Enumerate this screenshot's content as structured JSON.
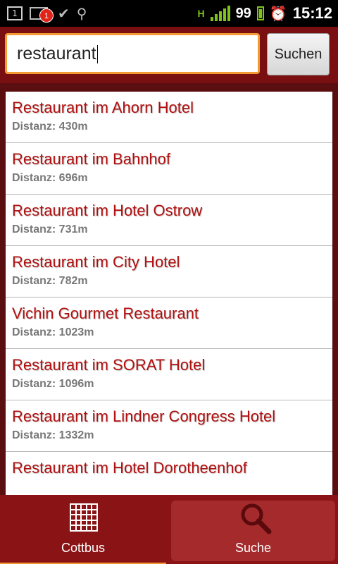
{
  "status_bar": {
    "sim_label": "1",
    "notification_badge": "1",
    "network_type": "H",
    "battery": "99",
    "time": "15:12",
    "icons": [
      "sim-icon",
      "mail-icon",
      "shopping-bag-icon",
      "usb-icon",
      "hspa-icon",
      "signal-icon",
      "battery-icon",
      "alarm-icon"
    ]
  },
  "search": {
    "value": "restaurant",
    "button_label": "Suchen"
  },
  "results": [
    {
      "name": "Restaurant im Ahorn Hotel",
      "distance": "Distanz: 430m"
    },
    {
      "name": "Restaurant im Bahnhof",
      "distance": "Distanz: 696m"
    },
    {
      "name": "Restaurant im Hotel Ostrow",
      "distance": "Distanz: 731m"
    },
    {
      "name": "Restaurant im City Hotel",
      "distance": "Distanz: 782m"
    },
    {
      "name": "Vichin Gourmet Restaurant",
      "distance": "Distanz: 1023m"
    },
    {
      "name": "Restaurant im SORAT Hotel",
      "distance": "Distanz: 1096m"
    },
    {
      "name": "Restaurant im Lindner Congress Hotel",
      "distance": "Distanz: 1332m"
    },
    {
      "name": "Restaurant im Hotel Dorotheenhof",
      "distance": ""
    }
  ],
  "tabs": {
    "cottbus": {
      "label": "Cottbus",
      "icon": "grid-icon"
    },
    "suche": {
      "label": "Suche",
      "icon": "search-icon"
    }
  },
  "colors": {
    "accent": "#f39a35",
    "header": "#7a0f12",
    "title_text": "#b10f0f"
  }
}
